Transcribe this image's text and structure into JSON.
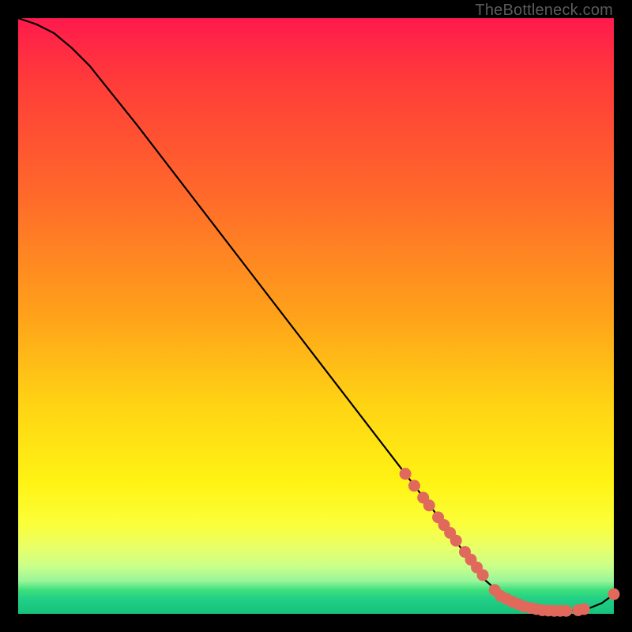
{
  "watermark": "TheBottleneck.com",
  "colors": {
    "background": "#000000",
    "curve": "#000000",
    "points_fill": "#e0695c",
    "points_stroke": "#c94f44"
  },
  "chart_data": {
    "type": "line",
    "title": "",
    "xlabel": "",
    "ylabel": "",
    "xlim": [
      0,
      100
    ],
    "ylim": [
      0,
      100
    ],
    "series": [
      {
        "name": "bottleneck-curve",
        "x": [
          0,
          3,
          6,
          9,
          12,
          20,
          30,
          40,
          50,
          60,
          70,
          78,
          82,
          85,
          88,
          90,
          92,
          94,
          96,
          98,
          100
        ],
        "y": [
          100,
          99,
          97.5,
          95,
          92,
          82,
          69,
          56,
          43,
          30,
          17,
          6,
          2.5,
          1.2,
          0.6,
          0.5,
          0.5,
          0.6,
          1.0,
          1.8,
          3.3
        ]
      }
    ],
    "scatter_points": {
      "name": "highlighted-points",
      "x": [
        65,
        66.5,
        68,
        69,
        70.5,
        71.5,
        72.5,
        73.5,
        75,
        76,
        77,
        78,
        80,
        81,
        82,
        83,
        84,
        85,
        86,
        87,
        88,
        89,
        90,
        91,
        92,
        94,
        95,
        100
      ],
      "y": [
        23.5,
        21.5,
        19.5,
        18.2,
        16.2,
        14.9,
        13.6,
        12.3,
        10.4,
        9.1,
        7.8,
        6.5,
        4.0,
        3.0,
        2.5,
        2.0,
        1.6,
        1.2,
        1.0,
        0.8,
        0.6,
        0.55,
        0.5,
        0.5,
        0.5,
        0.6,
        0.8,
        3.3
      ]
    }
  }
}
